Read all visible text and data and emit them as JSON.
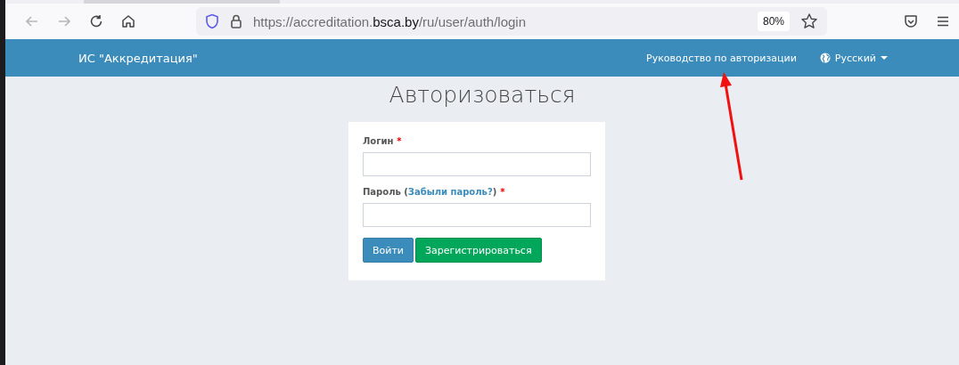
{
  "browser": {
    "url": {
      "prefix": "https://accreditation.",
      "domain": "bsca.by",
      "path": "/ru/user/auth/login"
    },
    "zoom": "80%"
  },
  "navbar": {
    "brand": "ИС \"Аккредитация\"",
    "links": [
      {
        "kind": "link",
        "label": "Руководство по авторизации"
      },
      {
        "kind": "language",
        "label": "Русский"
      }
    ]
  },
  "page": {
    "title": "Авторизоваться"
  },
  "form": {
    "fields": [
      {
        "label": "Логин",
        "required": true,
        "mark": "*"
      },
      {
        "label": "Пароль (",
        "link": "Забыли пароль?",
        "after": ")",
        "required": true,
        "mark": "*"
      }
    ],
    "buttons": [
      {
        "kind": "primary",
        "label": "Войти"
      },
      {
        "kind": "success",
        "label": "Зарегистрироваться"
      }
    ]
  }
}
